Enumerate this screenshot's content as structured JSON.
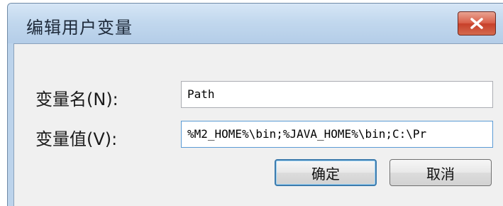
{
  "dialog": {
    "title": "编辑用户变量",
    "close_icon": "close-icon"
  },
  "form": {
    "name_label": "变量名(N):",
    "name_value": "Path",
    "value_label": "变量值(V):",
    "value_value": "%M2_HOME%\\bin;%JAVA_HOME%\\bin;C:\\Pr"
  },
  "buttons": {
    "ok_label": "确定",
    "cancel_label": "取消"
  },
  "colors": {
    "titlebar": "#c2d8ee",
    "close_button": "#c7402a",
    "client_background": "#f0f0f0"
  }
}
